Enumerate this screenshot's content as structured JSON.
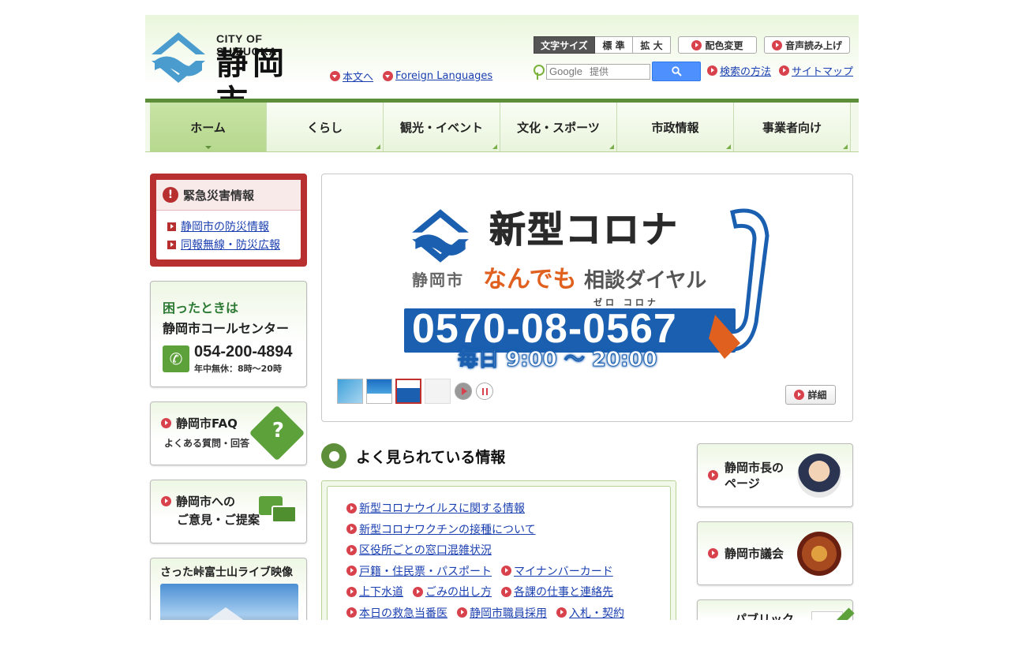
{
  "header": {
    "logo_en": "CITY OF SHIZUOKA",
    "logo_ja": "静岡市",
    "links": [
      {
        "label": "本文へ"
      },
      {
        "label": "Foreign Languages"
      }
    ],
    "font_size_label": "文字サイズ",
    "font_size_standard": "標 準",
    "font_size_large": "拡 大",
    "color_change": "配色変更",
    "read_aloud": "音声読み上げ",
    "search_placeholder": "提供",
    "search_brand": "Google",
    "search_help": "検索の方法",
    "sitemap": "サイトマップ"
  },
  "nav": {
    "items": [
      {
        "label": "ホーム",
        "active": true
      },
      {
        "label": "くらし"
      },
      {
        "label": "観光・イベント"
      },
      {
        "label": "文化・スポーツ"
      },
      {
        "label": "市政情報"
      },
      {
        "label": "事業者向け"
      }
    ]
  },
  "sidebar": {
    "emergency_title": "緊急災害情報",
    "emergency_links": [
      "静岡市の防災情報",
      "同報無線・防災広報"
    ],
    "call_title": "困ったときは",
    "call_name": "静岡市コールセンター",
    "call_number": "054-200-4894",
    "call_hours": "年中無休：8時〜20時",
    "faq_title": "静岡市FAQ",
    "faq_sub": "よくある質問・回答",
    "faq_mark": "?",
    "opinion_title": "静岡市への",
    "opinion_sub": "ご意見・ご提案",
    "fuji_title": "さった峠富士山ライブ映像"
  },
  "carousel": {
    "slide_city": "静岡市",
    "slide_title": "新型コロナ",
    "slide_emphasis": "なんでも",
    "slide_rest": "相談ダイヤル",
    "slide_ruby": "ゼロ  コロナ",
    "slide_phone": "0570-08-0567",
    "slide_hours": "毎日 9:00 〜 20:00",
    "detail_label": "詳細",
    "thumb_count": 4,
    "active_thumb": 3
  },
  "popular": {
    "title": "よく見られている情報",
    "rows": [
      [
        "新型コロナウイルスに関する情報"
      ],
      [
        "新型コロナワクチンの接種について"
      ],
      [
        "区役所ごとの窓口混雑状況"
      ],
      [
        "戸籍・住民票・パスポート",
        "マイナンバーカード"
      ],
      [
        "上下水道",
        "ごみの出し方",
        "各課の仕事と連絡先"
      ],
      [
        "本日の救急当番医",
        "静岡市職員採用",
        "入札・契約"
      ]
    ]
  },
  "right_banners": {
    "mayor": "静岡市長の\nページ",
    "council": "静岡市議会",
    "public": "パブリック"
  },
  "colors": {
    "accent_green": "#5d8f3a",
    "emergency_red": "#b72f2f",
    "link_blue": "#1a3fb0",
    "bullet_red": "#d8424d"
  }
}
